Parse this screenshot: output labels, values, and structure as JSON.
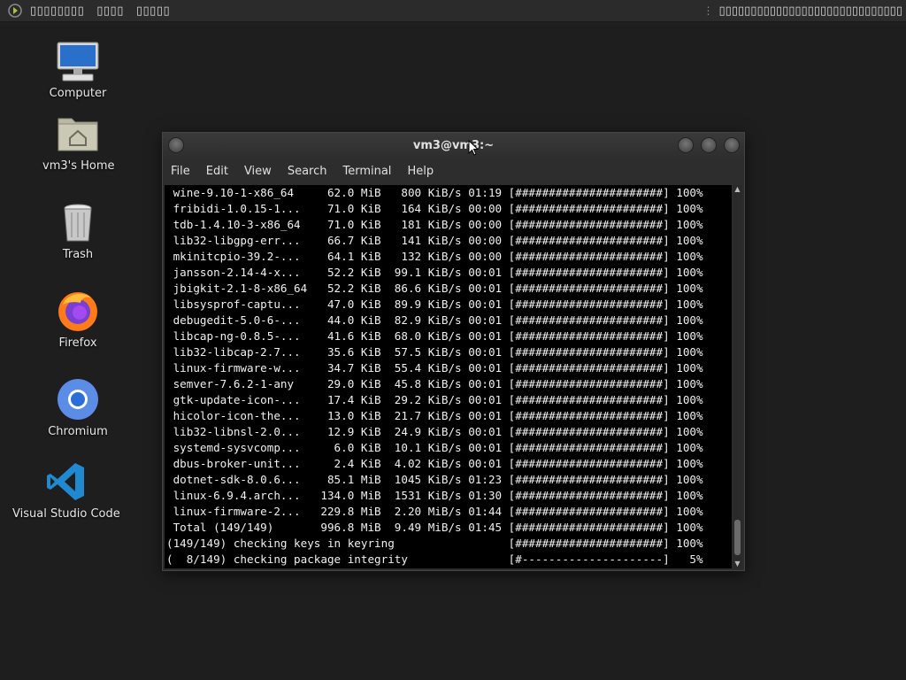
{
  "panel": {
    "menus": [
      "▯▯▯▯▯▯▯▯",
      "▯▯▯▯",
      "▯▯▯▯▯"
    ],
    "right_text": "▯▯▯▯▯▯▯▯▯▯▯▯▯▯▯▯▯▯▯▯▯▯▯▯▯▯▯▯▯"
  },
  "desktop": {
    "icons": [
      {
        "label": "Computer",
        "icon": "computer-icon"
      },
      {
        "label": "vm3's Home",
        "icon": "home-folder-icon"
      },
      {
        "label": "Trash",
        "icon": "trash-icon"
      },
      {
        "label": "Firefox",
        "icon": "firefox-icon"
      },
      {
        "label": "Chromium",
        "icon": "chromium-icon"
      },
      {
        "label": "Visual Studio Code",
        "icon": "vscode-icon"
      }
    ]
  },
  "terminal": {
    "title": "vm3@vm3:~",
    "menu": [
      "File",
      "Edit",
      "View",
      "Search",
      "Terminal",
      "Help"
    ],
    "lines": [
      " wine-9.10-1-x86_64     62.0 MiB   800 KiB/s 01:19 [######################] 100%",
      " fribidi-1.0.15-1...    71.0 KiB   164 KiB/s 00:00 [######################] 100%",
      " tdb-1.4.10-3-x86_64    71.0 KiB   181 KiB/s 00:00 [######################] 100%",
      " lib32-libgpg-err...    66.7 KiB   141 KiB/s 00:00 [######################] 100%",
      " mkinitcpio-39.2-...    64.1 KiB   132 KiB/s 00:00 [######################] 100%",
      " jansson-2.14-4-x...    52.2 KiB  99.1 KiB/s 00:01 [######################] 100%",
      " jbigkit-2.1-8-x86_64   52.2 KiB  86.6 KiB/s 00:01 [######################] 100%",
      " libsysprof-captu...    47.0 KiB  89.9 KiB/s 00:01 [######################] 100%",
      " debugedit-5.0-6-...    44.0 KiB  82.9 KiB/s 00:01 [######################] 100%",
      " libcap-ng-0.8.5-...    41.6 KiB  68.0 KiB/s 00:01 [######################] 100%",
      " lib32-libcap-2.7...    35.6 KiB  57.5 KiB/s 00:01 [######################] 100%",
      " linux-firmware-w...    34.7 KiB  55.4 KiB/s 00:01 [######################] 100%",
      " semver-7.6.2-1-any     29.0 KiB  45.8 KiB/s 00:01 [######################] 100%",
      " gtk-update-icon-...    17.4 KiB  29.2 KiB/s 00:01 [######################] 100%",
      " hicolor-icon-the...    13.0 KiB  21.7 KiB/s 00:01 [######################] 100%",
      " lib32-libnsl-2.0...    12.9 KiB  24.9 KiB/s 00:01 [######################] 100%",
      " systemd-sysvcomp...     6.0 KiB  10.1 KiB/s 00:01 [######################] 100%",
      " dbus-broker-unit...     2.4 KiB  4.02 KiB/s 00:01 [######################] 100%",
      " dotnet-sdk-8.0.6...    85.1 MiB  1045 KiB/s 01:23 [######################] 100%",
      " linux-6.9.4.arch...   134.0 MiB  1531 KiB/s 01:30 [######################] 100%",
      " linux-firmware-2...   229.8 MiB  2.20 MiB/s 01:44 [######################] 100%",
      " Total (149/149)       996.8 MiB  9.49 MiB/s 01:45 [######################] 100%",
      "(149/149) checking keys in keyring                 [######################] 100%",
      "(  8/149) checking package integrity               [#---------------------]   5%"
    ]
  }
}
